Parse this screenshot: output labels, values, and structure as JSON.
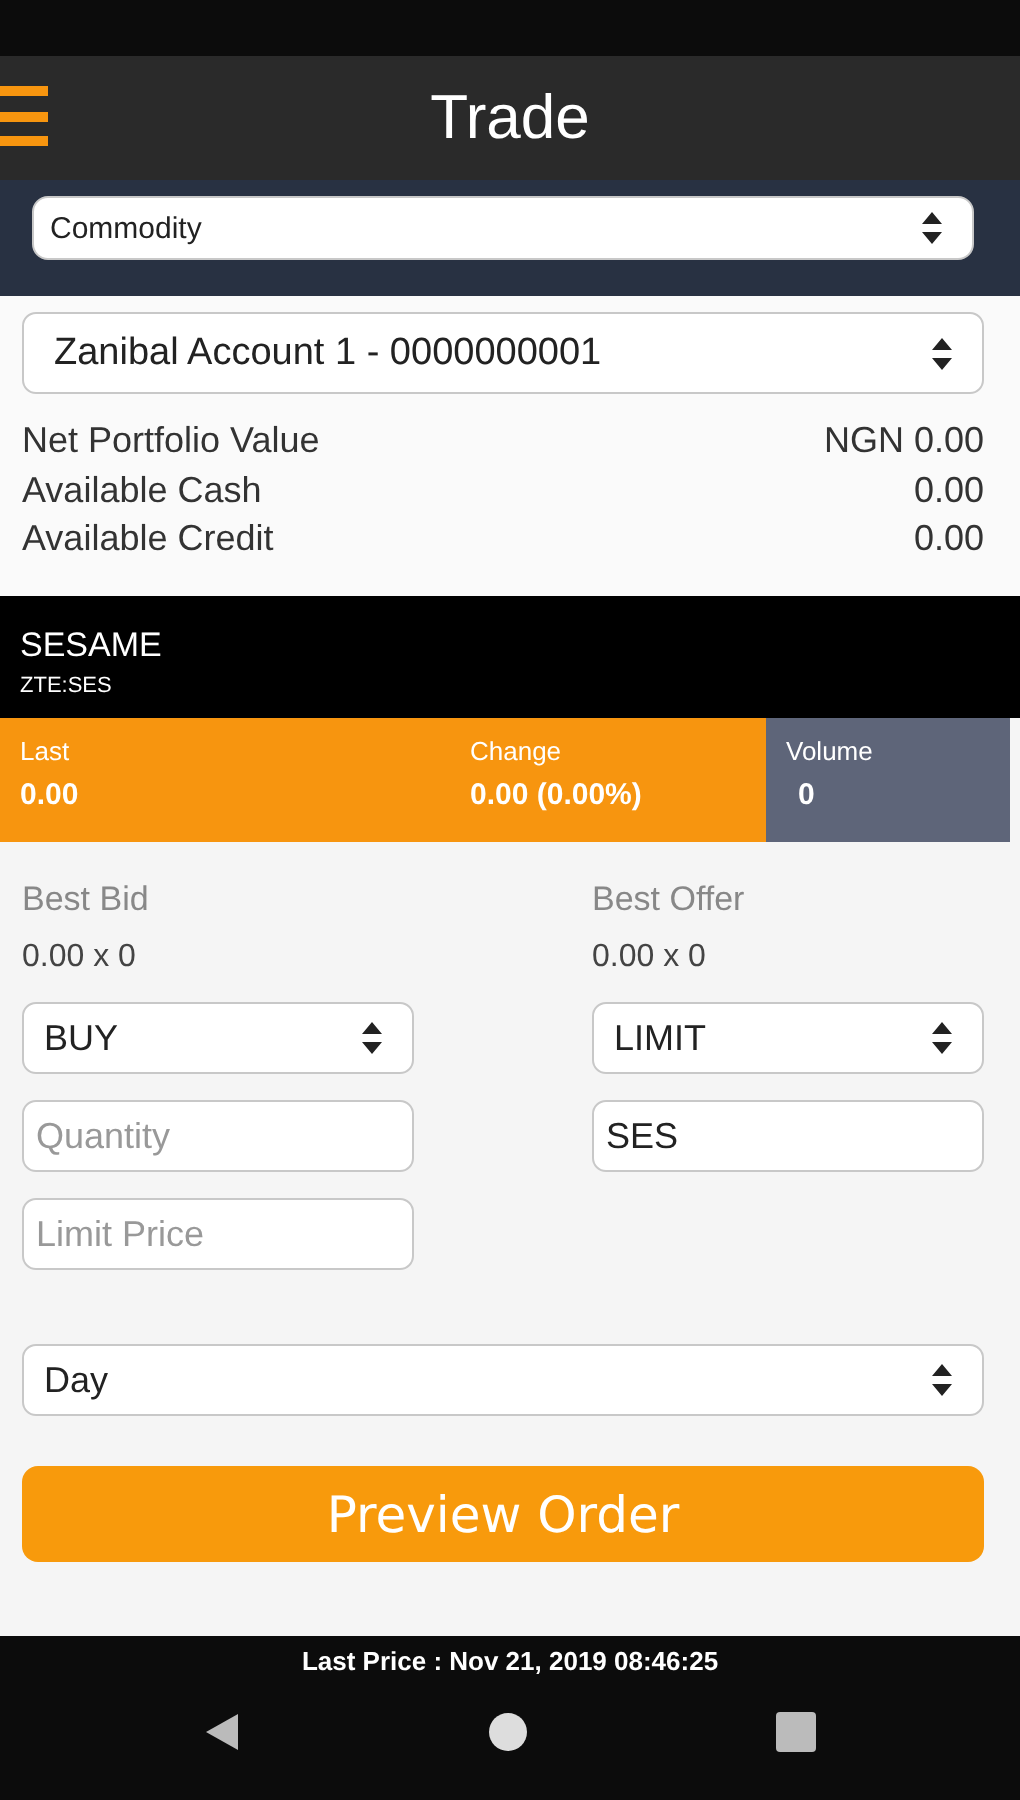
{
  "app_bar": {
    "title": "Trade"
  },
  "market_select": {
    "value": "Commodity"
  },
  "account_select": {
    "value": "Zanibal Account 1 - 0000000001"
  },
  "balances": [
    {
      "label": "Net Portfolio Value",
      "value": "NGN 0.00"
    },
    {
      "label": "Available Cash",
      "value": "0.00"
    },
    {
      "label": "Available Credit",
      "value": "0.00"
    }
  ],
  "instrument": {
    "name": "SESAME",
    "symbol": "ZTE:SES"
  },
  "quote": [
    {
      "label": "Last",
      "value": "0.00",
      "kind": "price"
    },
    {
      "label": "Change",
      "value": "0.00 (0.00%)",
      "kind": "price"
    },
    {
      "label": "Volume",
      "value": "0",
      "kind": "volume"
    }
  ],
  "best_bid": {
    "label": "Best Bid",
    "value": "0.00 x 0"
  },
  "best_offer": {
    "label": "Best Offer",
    "value": "0.00 x 0"
  },
  "side_select": {
    "value": "BUY"
  },
  "order_type_select": {
    "value": "LIMIT"
  },
  "quantity_field": {
    "placeholder": "Quantity"
  },
  "symbol_field": {
    "value": "SES"
  },
  "limit_price_field": {
    "placeholder": "Limit Price"
  },
  "duration_select": {
    "value": "Day"
  },
  "preview_button": {
    "label": "Preview Order"
  },
  "footer": {
    "last_price": "Last Price : Nov 21, 2019 08:46:25"
  }
}
